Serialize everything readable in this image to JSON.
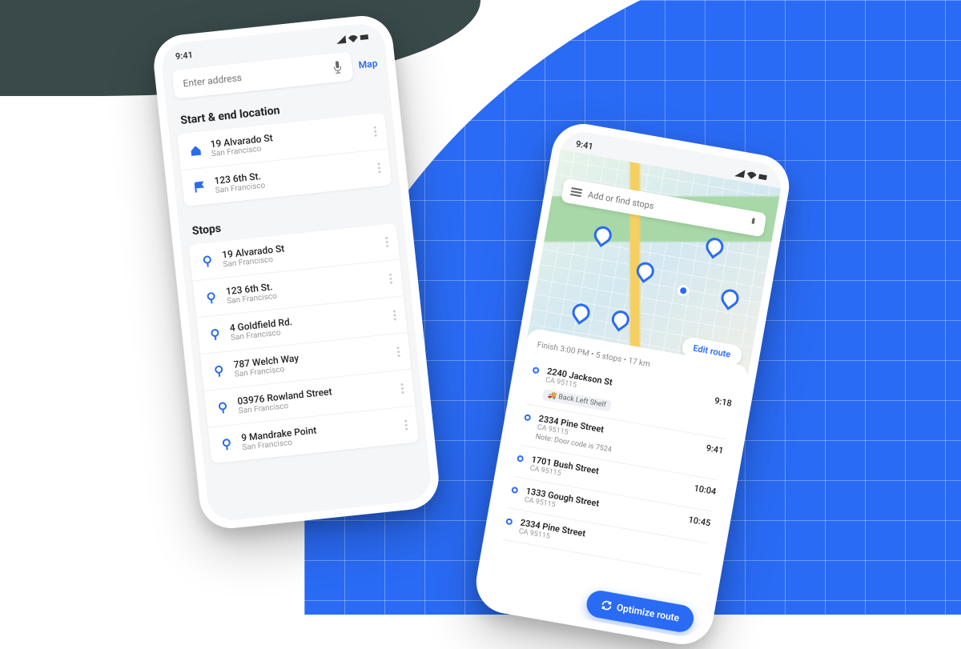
{
  "status_time": "9:41",
  "phone1": {
    "search_placeholder": "Enter address",
    "map_link": "Map",
    "section1_title": "Start & end location",
    "start": {
      "title": "19 Alvarado St",
      "sub": "San Francisco"
    },
    "end": {
      "title": "123 6th St.",
      "sub": "San Francisco"
    },
    "section2_title": "Stops",
    "stops": [
      {
        "title": "19 Alvarado St",
        "sub": "San Francisco"
      },
      {
        "title": "123 6th St.",
        "sub": "San Francisco"
      },
      {
        "title": "4 Goldfield Rd.",
        "sub": "San Francisco"
      },
      {
        "title": "787 Welch Way",
        "sub": "San Francisco"
      },
      {
        "title": "03976 Rowland Street",
        "sub": "San Francisco"
      },
      {
        "title": "9 Mandrake Point",
        "sub": "San Francisco"
      }
    ]
  },
  "phone2": {
    "search_placeholder": "Add or find stops",
    "edit_route": "Edit route",
    "summary": "Finish 3:00 PM • 5 stops • 17 km",
    "optimize": "Optimize route",
    "stops": [
      {
        "title": "2240 Jackson St",
        "sub": "CA 95115",
        "tag": "Back Left Shelf",
        "time": "9:18"
      },
      {
        "title": "2334 Pine Street",
        "sub": "CA 95115",
        "note": "Note: Door code is 7524",
        "time": "9:41"
      },
      {
        "title": "1701 Bush Street",
        "sub": "CA 95115",
        "time": "10:04"
      },
      {
        "title": "1333 Gough Street",
        "sub": "CA 95115",
        "time": "10:45"
      },
      {
        "title": "2334 Pine Street",
        "sub": "CA 95115",
        "time": ""
      }
    ]
  }
}
